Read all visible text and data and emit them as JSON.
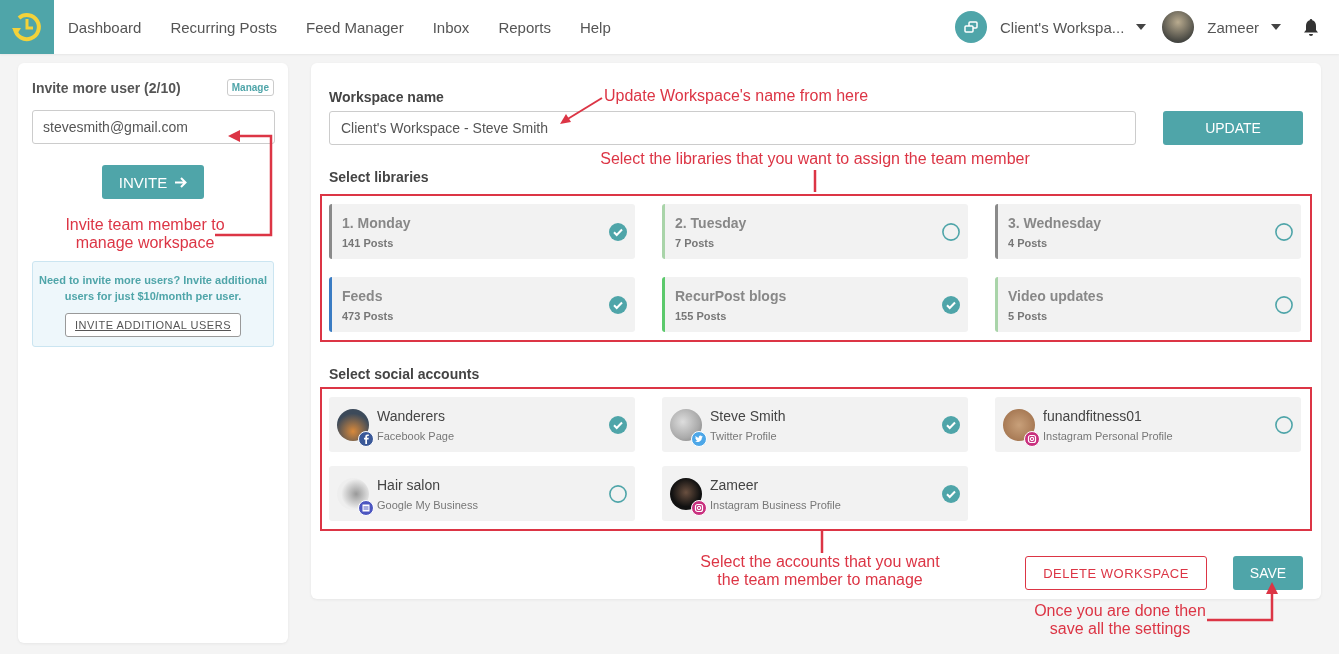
{
  "nav": {
    "menu": [
      "Dashboard",
      "Recurring Posts",
      "Feed Manager",
      "Inbox",
      "Reports",
      "Help"
    ],
    "workspace": "Client's Workspa...",
    "user": "Zameer"
  },
  "invite_panel": {
    "title": "Invite more user (2/10)",
    "manage_button": "Manage",
    "email": {
      "value": "stevesmith@gmail.com"
    },
    "invite_button": "INVITE",
    "note": "Need to invite more users? Invite additional users for just $10/month per user.",
    "additional_button": "INVITE ADDITIONAL USERS"
  },
  "workspace": {
    "name_label": "Workspace name",
    "name": {
      "value": "Client's Workspace - Steve Smith"
    },
    "update_button": "UPDATE",
    "libraries_label": "Select libraries",
    "libraries": [
      {
        "name": "1. Monday",
        "count": "141 Posts",
        "color": "#8a8a8a",
        "selected": true
      },
      {
        "name": "2. Tuesday",
        "count": "7 Posts",
        "color": "#a9d4a9",
        "selected": false
      },
      {
        "name": "3. Wednesday",
        "count": "4 Posts",
        "color": "#8a8a8a",
        "selected": false
      },
      {
        "name": "Feeds",
        "count": "473 Posts",
        "color": "#3a7cc3",
        "selected": true
      },
      {
        "name": "RecurPost blogs",
        "count": "155 Posts",
        "color": "#5cc96c",
        "selected": true
      },
      {
        "name": "Video updates",
        "count": "5 Posts",
        "color": "#a9d4a9",
        "selected": false
      }
    ],
    "accounts_label": "Select social accounts",
    "accounts": [
      {
        "name": "Wanderers",
        "type": "Facebook Page",
        "kind": "facebook",
        "selected": true
      },
      {
        "name": "Steve Smith",
        "type": "Twitter Profile",
        "kind": "twitter",
        "selected": true
      },
      {
        "name": "funandfitness01",
        "type": "Instagram Personal Profile",
        "kind": "instagram",
        "selected": false
      },
      {
        "name": "Hair salon",
        "type": "Google My Business",
        "kind": "google",
        "selected": false
      },
      {
        "name": "Zameer",
        "type": "Instagram Business Profile",
        "kind": "instagram",
        "selected": true
      }
    ],
    "delete_button": "DELETE WORKSPACE",
    "save_button": "SAVE"
  },
  "annotations": [
    {
      "text": "Update Workspace's name from here"
    },
    {
      "text": "Select the libraries that you want to assign the team member"
    },
    {
      "text": "Invite team member to manage workspace"
    },
    {
      "text": "Select the accounts that you want the team member to manage"
    },
    {
      "text": "Once you are done then save all the settings"
    }
  ]
}
